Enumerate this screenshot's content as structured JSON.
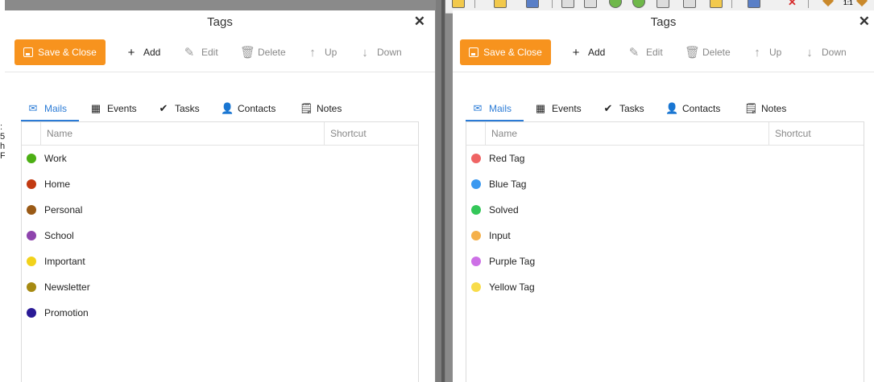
{
  "left_dialog": {
    "title": "Tags",
    "close": "✕",
    "toolbar": {
      "save_close": "Save & Close",
      "add": "Add",
      "edit": "Edit",
      "delete": "Delete",
      "up": "Up",
      "down": "Down"
    },
    "tabs": [
      "Mails",
      "Events",
      "Tasks",
      "Contacts",
      "Notes"
    ],
    "selected_tab": "Mails",
    "columns": {
      "name": "Name",
      "shortcut": "Shortcut"
    },
    "tags": [
      {
        "label": "Work",
        "color": "#4caf14"
      },
      {
        "label": "Home",
        "color": "#c23a11"
      },
      {
        "label": "Personal",
        "color": "#9a5a16"
      },
      {
        "label": "School",
        "color": "#8e44ad"
      },
      {
        "label": "Important",
        "color": "#f2d21b"
      },
      {
        "label": "Newsletter",
        "color": "#a68a12"
      },
      {
        "label": "Promotion",
        "color": "#2a1a96"
      }
    ]
  },
  "right_dialog": {
    "title": "Tags",
    "close": "✕",
    "toolbar": {
      "save_close": "Save & Close",
      "add": "Add",
      "edit": "Edit",
      "delete": "Delete",
      "up": "Up",
      "down": "Down"
    },
    "tabs": [
      "Mails",
      "Events",
      "Tasks",
      "Contacts",
      "Notes"
    ],
    "selected_tab": "Mails",
    "columns": {
      "name": "Name",
      "shortcut": "Shortcut"
    },
    "tags": [
      {
        "label": "Red Tag",
        "color": "#ef6464"
      },
      {
        "label": "Blue Tag",
        "color": "#3b99f0"
      },
      {
        "label": "Solved",
        "color": "#34c759"
      },
      {
        "label": "Input",
        "color": "#f5b04a"
      },
      {
        "label": "Purple Tag",
        "color": "#cd70e6"
      },
      {
        "label": "Yellow Tag",
        "color": "#f8dc4a"
      }
    ]
  },
  "background_text": ":\n5\nh\nF",
  "accent_color": "#f7931e",
  "tab_accent": "#2b7bd6"
}
